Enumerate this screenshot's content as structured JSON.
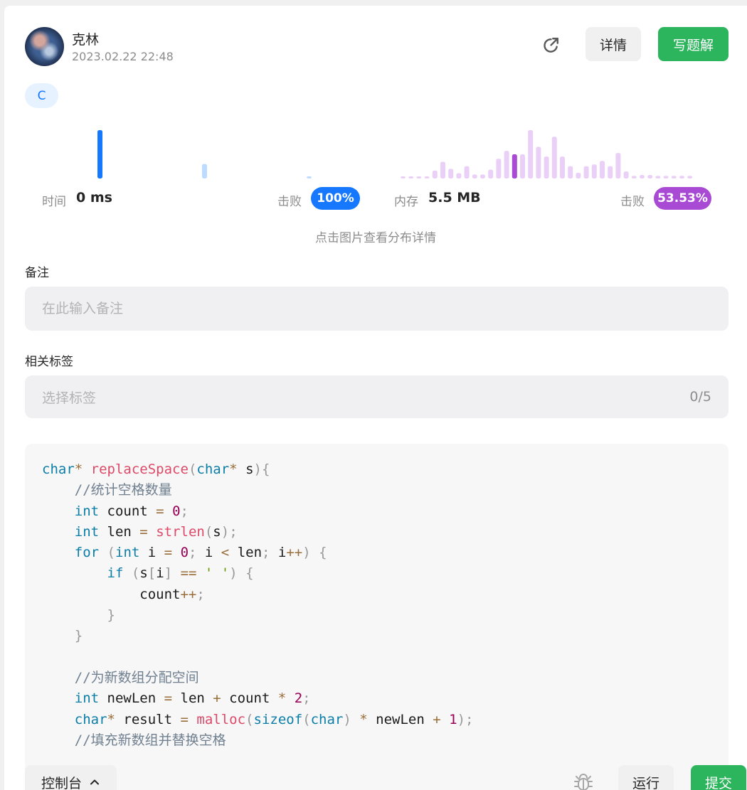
{
  "user": {
    "name": "克林",
    "time": "2023.02.22 22:48"
  },
  "header": {
    "details_label": "详情",
    "write_label": "写题解"
  },
  "language": "C",
  "stats": {
    "time_label": "时间",
    "time_value": "0 ms",
    "time_beat_label": "击败",
    "time_beat_value": "100%",
    "memory_label": "内存",
    "memory_value": "5.5 MB",
    "memory_beat_label": "击败",
    "memory_beat_value": "53.53%",
    "hint": "点击图片查看分布详情"
  },
  "chart_data": [
    {
      "type": "bar",
      "series": [
        {
          "values": [
            100,
            30,
            4
          ]
        }
      ],
      "selected_index": 0,
      "color": "#1677ff",
      "faded_color": "#bcdcff"
    },
    {
      "type": "bar",
      "series": [
        {
          "values": [
            4,
            4,
            4,
            4,
            18,
            38,
            22,
            12,
            28,
            9,
            9,
            20,
            45,
            63,
            55,
            55,
            110,
            72,
            50,
            95,
            50,
            28,
            13,
            28,
            32,
            40,
            28,
            58,
            16,
            6,
            8,
            8,
            6,
            6,
            6,
            6,
            6
          ]
        }
      ],
      "selected_index": 14,
      "color": "#a84ad4",
      "faded_color": "#ead0f6"
    }
  ],
  "form": {
    "note_title": "备注",
    "note_placeholder": "在此输入备注",
    "tags_title": "相关标签",
    "tags_placeholder": "选择标签",
    "tags_count": "0/5"
  },
  "bottom": {
    "console_label": "控制台",
    "run_label": "运行",
    "submit_label": "提交"
  },
  "icons": {
    "share": "share-icon",
    "chevron": "chevron-up-icon",
    "bug": "bug-icon"
  },
  "colors": {
    "green": "#2db55d",
    "blue": "#1677ff",
    "purple": "#a84ad4"
  }
}
